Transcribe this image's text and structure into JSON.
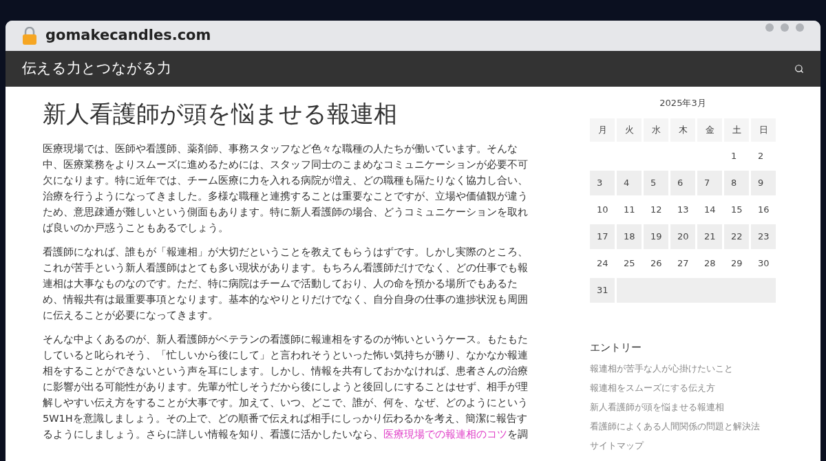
{
  "browser": {
    "url": "gomakecandles.com"
  },
  "site": {
    "title": "伝える力とつながる力"
  },
  "article": {
    "title": "新人看護師が頭を悩ませる報連相",
    "paragraphs": [
      {
        "text": "医療現場では、医師や看護師、薬剤師、事務スタッフなど色々な職種の人たちが働いています。そんな中、医療業務をよりスムーズに進めるためには、スタッフ同士のこまめなコミュニケーションが必要不可欠になります。特に近年では、チーム医療に力を入れる病院が増え、どの職種も隔たりなく協力し合い、治療を行うようになってきました。多様な職種と連携することは重要なことですが、立場や価値観が違うため、意思疎通が難しいという側面もあります。特に新人看護師の場合、どうコミュニケーションを取れば良いのか戸惑うこともあるでしょう。"
      },
      {
        "text": "看護師になれば、誰もが「報連相」が大切だということを教えてもらうはずです。しかし実際のところ、これが苦手という新人看護師はとても多い現状があります。もちろん看護師だけでなく、どの仕事でも報連相は大事なものなのです。ただ、特に病院はチームで活動しており、人の命を預かる場所でもあるため、情報共有は最重要事項となります。基本的なやりとりだけでなく、自分自身の仕事の進捗状況も周囲に伝えることが必要になってきます。"
      },
      {
        "text": "そんな中よくあるのが、新人看護師がベテランの看護師に報連相をするのが怖いというケース。もたもたしていると叱られそう、「忙しいから後にして」と言われそうといった怖い気持ちが勝り、なかなか報連相をすることができないという声を耳にします。しかし、情報を共有しておかなければ、患者さんの治療に影響が出る可能性があります。先輩が忙しそうだから後にしようと後回しにすることはせず、相手が理解しやすい伝え方をすることが大事です。加えて、いつ、どこで、誰が、何を、なぜ、どのようにという5W1Hを意識しましょう。その上で、どの順番で伝えれば相手にしっかり伝わるかを考え、簡潔に報告するようにしましょう。さらに詳しい情報を知り、看護に活かしたいなら、",
        "link": "医療現場での報連相のコツ",
        "after": "を調"
      }
    ]
  },
  "calendar": {
    "caption": "2025年3月",
    "weekdays": [
      "月",
      "火",
      "水",
      "木",
      "金",
      "土",
      "日"
    ],
    "weeks": [
      {
        "shaded": false,
        "days": [
          "1",
          "2"
        ]
      },
      {
        "shaded": true,
        "days": [
          "3",
          "4",
          "5",
          "6",
          "7",
          "8",
          "9"
        ]
      },
      {
        "shaded": false,
        "days": [
          "10",
          "11",
          "12",
          "13",
          "14",
          "15",
          "16"
        ]
      },
      {
        "shaded": true,
        "days": [
          "17",
          "18",
          "19",
          "20",
          "21",
          "22",
          "23"
        ]
      },
      {
        "shaded": false,
        "days": [
          "24",
          "25",
          "26",
          "27",
          "28",
          "29",
          "30"
        ]
      },
      {
        "shaded": true,
        "days": [
          "31"
        ]
      }
    ]
  },
  "entries": {
    "heading": "エントリー",
    "items": [
      "報連相が苦手な人が心掛けたいこと",
      "報連相をスムーズにする伝え方",
      "新人看護師が頭を悩ませる報連相",
      "看護師によくある人間関係の問題と解決法",
      "サイトマップ"
    ]
  }
}
